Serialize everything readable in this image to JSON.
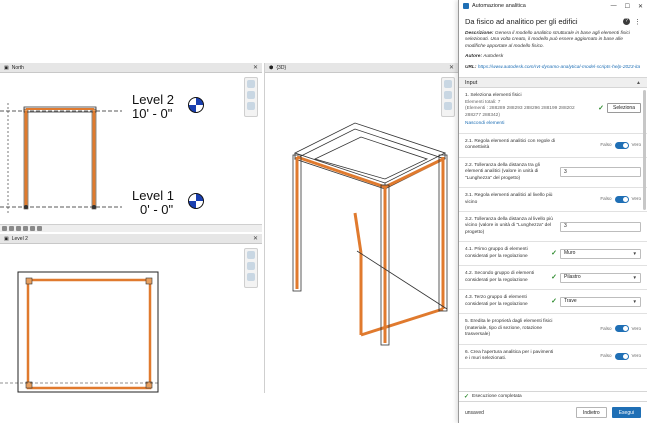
{
  "views": {
    "north": {
      "tab": "North",
      "level2_name": "Level 2",
      "level2_elev": "10' - 0\"",
      "level1_name": "Level 1",
      "level1_elev": "0' - 0\""
    },
    "level2": {
      "tab": "Level 2"
    },
    "threeD": {
      "tab": "{3D}"
    }
  },
  "dialog": {
    "window_title": "Automazione analitica",
    "title": "Da fisico ad analitico per gli edifici",
    "description_label": "Descrizione:",
    "description": "Genera il modello analitico strutturale in base agli elementi fisici selezionati. Una volta creato, il modello può essere aggiornato in base alle modifiche apportate al modello fisico.",
    "author_label": "Autore:",
    "author": "Autodesk",
    "url_label": "URL:",
    "url": "https://www.autodesk.com/rvt-dynamo-analytical-model-scripts-help-2023-ita",
    "section": "Input",
    "select": {
      "label": "1. Seleziona elementi fisici",
      "count_label": "Elementi totali: 7",
      "ids": "(Elementi : 288289 288293 288296 288199 288202 288277 288342)",
      "button": "Seleziona",
      "hide_link": "Nascondi elementi"
    },
    "rows": [
      {
        "label": "2.1. Regola elementi analitici con regole di connettività",
        "type": "toggle",
        "off": "Falso",
        "on": "Vero"
      },
      {
        "label": "2.2. Tolleranza della distanza tra gli elementi analitici (valore in unità di \"Lunghezza\" del progetto)",
        "type": "number",
        "value": "3"
      },
      {
        "label": "3.1. Regola elementi analitici al livello più vicino",
        "type": "toggle",
        "off": "Falso",
        "on": "Vero"
      },
      {
        "label": "3.2. Tolleranza della distanza al livello più vicino (valore in unità di \"Lunghezza\" del progetto)",
        "type": "number",
        "value": "3"
      },
      {
        "label": "4.1. Primo gruppo di elementi considerati per la regolazione",
        "type": "select",
        "value": "Muro"
      },
      {
        "label": "4.2. Secondo gruppo di elementi considerati per la regolazione",
        "type": "select",
        "value": "Pilastro"
      },
      {
        "label": "4.3. Terzo gruppo di elementi considerati per la regolazione",
        "type": "select",
        "value": "Trave"
      },
      {
        "label": "5. Eredita le proprietà dagli elementi fisici (materiale, tipo di sezione, rotazione trasversale)",
        "type": "toggle",
        "off": "Falso",
        "on": "Vero"
      },
      {
        "label": "6. Crea l'apertura analitica per i pavimenti e i muri selezionati.",
        "type": "toggle",
        "off": "Falso",
        "on": "Vero"
      }
    ],
    "status": "Esecuzione completata",
    "footer": {
      "unsaved": "unsaved",
      "back": "Indietro",
      "run": "Esegui"
    }
  }
}
